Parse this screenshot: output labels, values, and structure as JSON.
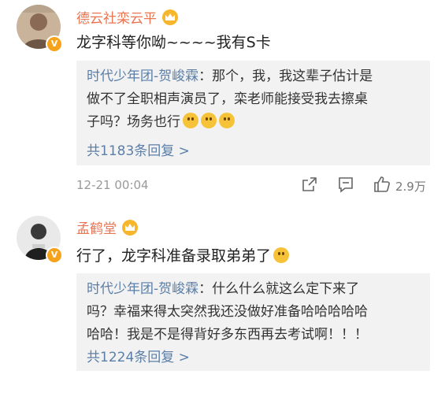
{
  "comments": [
    {
      "username": "德云社栾云平",
      "avatar_icon": "user-avatar-icon",
      "verified_icon": "verified-v-badge-icon",
      "member_icon": "crown-member-icon",
      "text": "龙字科等你呦~~~~我有S卡",
      "reply": {
        "author": "时代少年团-贺峻霖",
        "body_lines": [
          "：那个，我，我这辈子估计是",
          "做不了全职相声演员了，栾老师能接受我去擦桌",
          "子吗？场务也行"
        ],
        "emoji_count": 3,
        "emoji_icon": "hushed-face-emoji-icon",
        "more_label": "共1183条回复 >"
      },
      "timestamp": "12-21 00:04",
      "like_count": "2.9万"
    },
    {
      "username": "孟鹤堂",
      "avatar_icon": "user-avatar-icon",
      "verified_icon": "verified-v-badge-icon",
      "member_icon": "crown-member-icon",
      "text": "行了，龙字科准备录取弟弟了",
      "text_emoji_icon": "laughing-tears-emoji-icon",
      "reply": {
        "author": "时代少年团-贺峻霖",
        "body_lines": [
          "：什么什么就这么定下来了",
          "吗？幸福来得太突然我还没做好准备哈哈哈哈哈",
          "哈哈！我是不是得背好多东西再去考试啊！！！"
        ],
        "more_label": "共1224条回复 >"
      }
    }
  ],
  "actions": {
    "share_icon": "share-icon",
    "comment_icon": "comment-icon",
    "like_icon": "thumbs-up-icon"
  },
  "colors": {
    "username": "#eb7350",
    "link": "#5b7fa8",
    "reply_bg": "#f2f2f2",
    "verified": "#f7a21b"
  }
}
